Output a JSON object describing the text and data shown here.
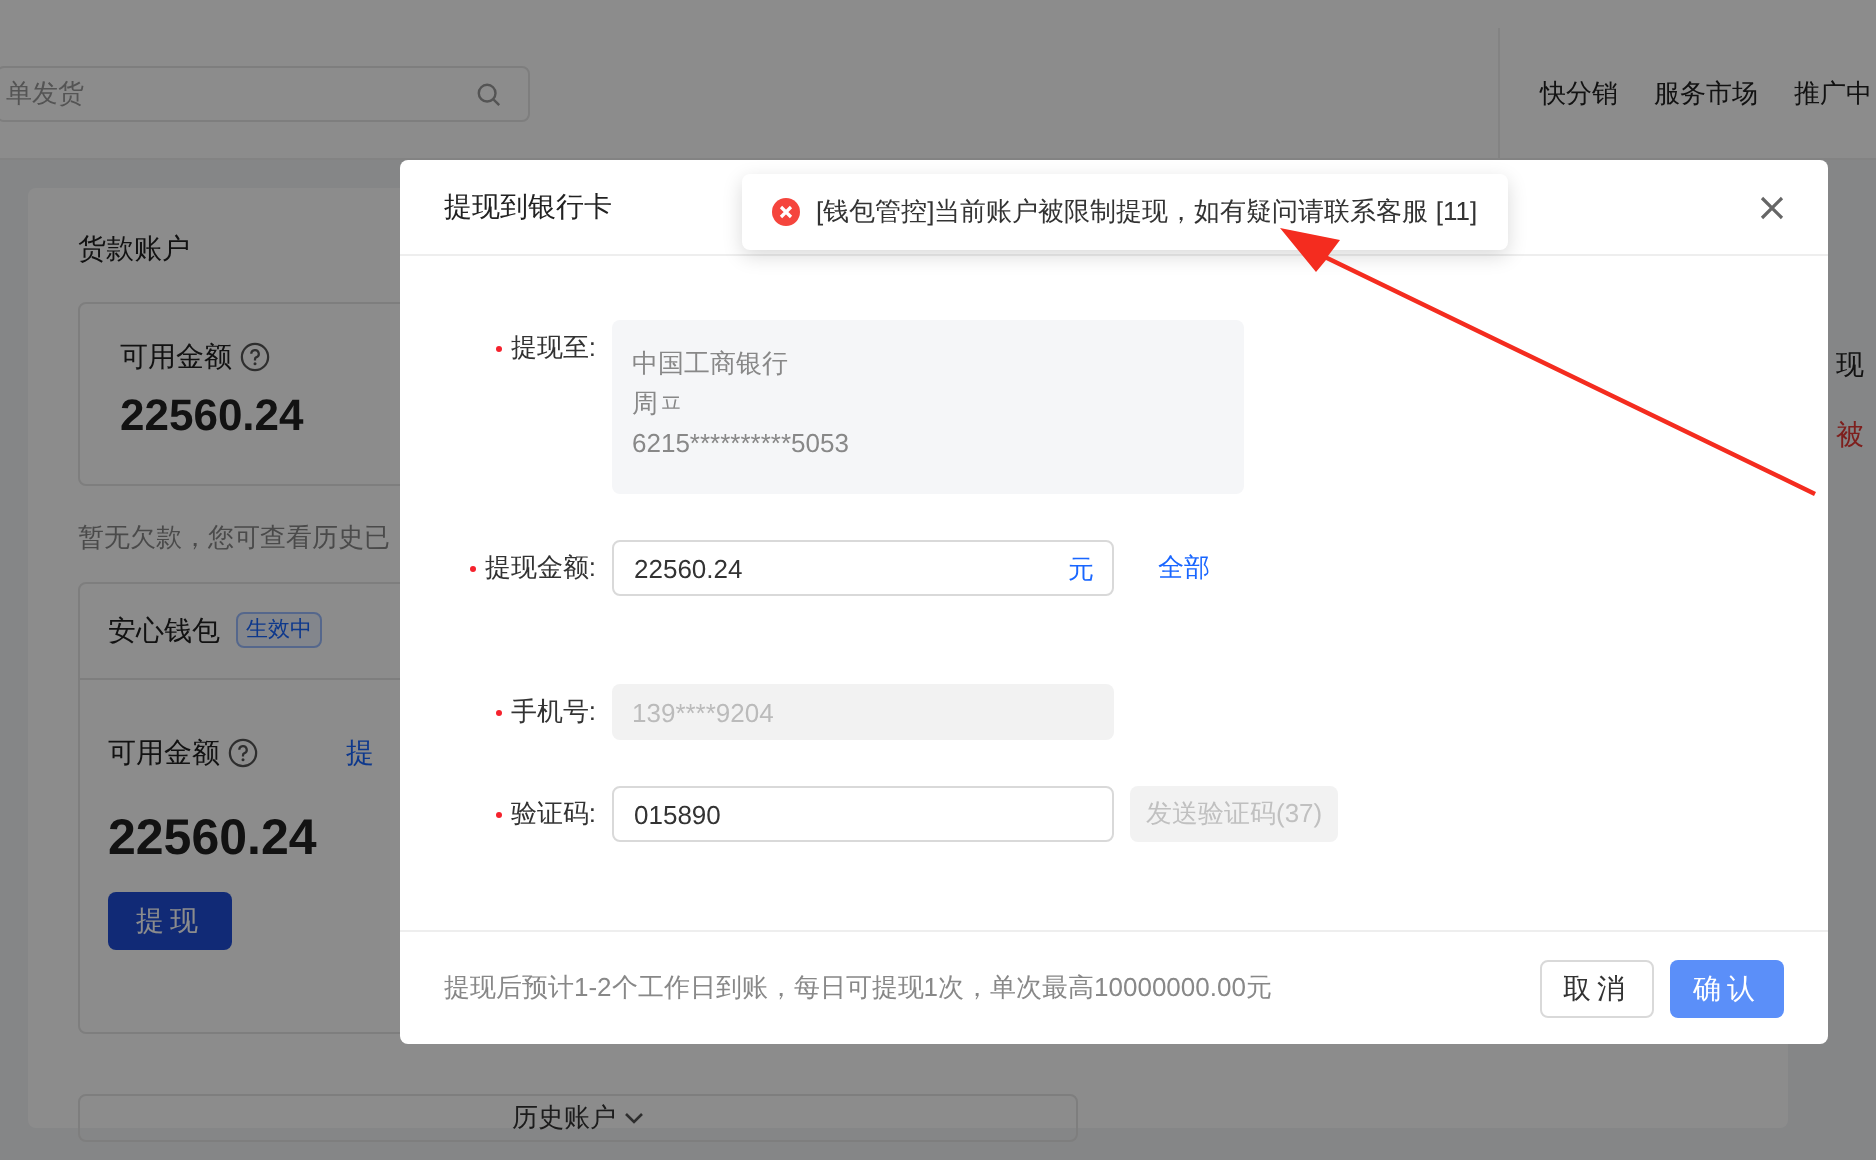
{
  "header": {
    "search": {
      "placeholder": "单发货"
    },
    "nav": [
      "快分销",
      "服务市场",
      "推广中"
    ]
  },
  "account": {
    "title": "货款账户",
    "balance_label": "可用金额",
    "balance": "22560.24",
    "note": "暂无欠款，您可查看历史已"
  },
  "wallet": {
    "title": "安心钱包",
    "badge": "生效中",
    "balance_label": "可用金额",
    "link": "提",
    "balance": "22560.24",
    "button": "提现"
  },
  "history_toggle": "历史账户",
  "right_panel": {
    "label": "现",
    "status": "被"
  },
  "dialog": {
    "title": "提现到银行卡",
    "fields": [
      {
        "kind": "card",
        "label": "提现至:",
        "required": true,
        "lines": [
          "中国工商银行",
          "周ㅍ",
          "6215**********5053"
        ]
      },
      {
        "kind": "amount",
        "label": "提现金额:",
        "required": true,
        "value": "22560.24",
        "unit": "元",
        "action": "全部"
      },
      {
        "kind": "readonly",
        "label": "手机号:",
        "required": true,
        "value": "139****9204"
      },
      {
        "kind": "code",
        "label": "验证码:",
        "required": true,
        "value": "015890",
        "button": "发送验证码(37)",
        "button_disabled": true
      }
    ],
    "footer_note": "提现后预计1-2个工作日到账，每日可提现1次，单次最高10000000.00元",
    "buttons": [
      {
        "label": "取消",
        "primary": false
      },
      {
        "label": "确认",
        "primary": true
      }
    ]
  },
  "toast": {
    "kind": "error",
    "text": "[钱包管控]当前账户被限制提现，如有疑问请联系客服 [11]"
  }
}
